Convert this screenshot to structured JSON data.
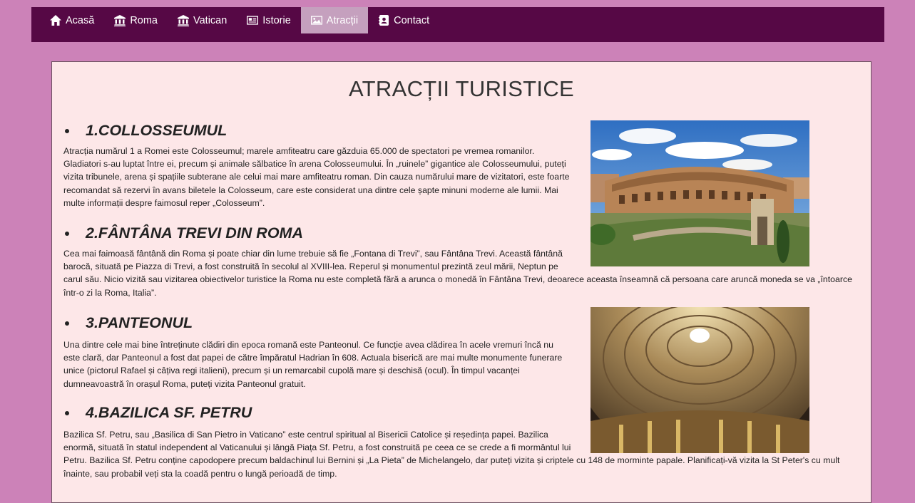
{
  "nav": {
    "items": [
      {
        "label": "Acasă",
        "icon": "home-icon"
      },
      {
        "label": "Roma",
        "icon": "bank-icon"
      },
      {
        "label": "Vatican",
        "icon": "bank-icon"
      },
      {
        "label": "Istorie",
        "icon": "newspaper-icon"
      },
      {
        "label": "Atracții",
        "icon": "picture-icon",
        "active": true
      },
      {
        "label": "Contact",
        "icon": "contact-book-icon"
      }
    ]
  },
  "page": {
    "title": "ATRACȚII TURISTICE",
    "sections": [
      {
        "heading": "1.COLLOSSEUMUL",
        "text": "Atracția numărul 1 a Romei este Colosseumul; marele amfiteatru care găzduia 65.000 de spectatori pe vremea romanilor. Gladiatori s-au luptat între ei, precum și animale sălbatice în arena Colosseumului. În „ruinele” gigantice ale Colosseumului, puteți vizita tribunele, arena și spațiile subterane ale celui mai mare amfiteatru roman. Din cauza numărului mare de vizitatori, este foarte recomandat să rezervi în avans biletele la Colosseum, care este considerat una dintre cele șapte minuni moderne ale lumii. Mai multe informații despre faimosul reper „Colosseum”."
      },
      {
        "heading": "2.FÂNTÂNA TREVI DIN ROMA",
        "text": "Cea mai faimoasă fântână din Roma și poate chiar din lume trebuie să fie „Fontana di Trevi”, sau Fântâna Trevi. Această fântână barocă, situată pe Piazza di Trevi, a fost construită în secolul al XVIII-lea. Reperul și monumentul prezintă zeul mării, Neptun pe carul său. Nicio vizită sau vizitarea obiectivelor turistice la Roma nu este completă fără a arunca o monedă în Fântâna Trevi, deoarece aceasta înseamnă că persoana care aruncă moneda se va „întoarce într-o zi la Roma, Italia”."
      },
      {
        "heading": "3.PANTEONUL",
        "text": "Una dintre cele mai bine întreținute clădiri din epoca romană este Panteonul. Ce funcție avea clădirea în acele vremuri încă nu este clară, dar Panteonul a fost dat papei de către împăratul Hadrian în 608. Actuala biserică are mai multe monumente funerare unice (pictorul Rafael și câțiva regi italieni), precum și un remarcabil cupolă mare și deschisă (ocul). În timpul vacanței dumneavoastră în orașul Roma, puteți vizita Panteonul gratuit."
      },
      {
        "heading": "4.BAZILICA SF. PETRU",
        "text": "Bazilica Sf. Petru, sau „Basilica di San Pietro in Vaticano” este centrul spiritual al Bisericii Catolice și reședința papei. Bazilica enormă, situată în statul independent al Vaticanului și lângă Piața Sf. Petru, a fost construită pe ceea ce se crede a fi mormântul lui Petru. Bazilica Sf. Petru conține capodopere precum baldachinul lui Bernini și „La Pieta” de Michelangelo, dar puteți vizita și criptele cu 148 de morminte papale. Planificați-vă vizita la St Peter's cu mult înainte, sau probabil veți sta la coadă pentru o lungă perioadă de timp."
      }
    ]
  },
  "colors": {
    "background": "#cc82b8",
    "navbar": "#560845",
    "nav_active": "#c5a0be",
    "content_bg": "#fde7e8"
  }
}
